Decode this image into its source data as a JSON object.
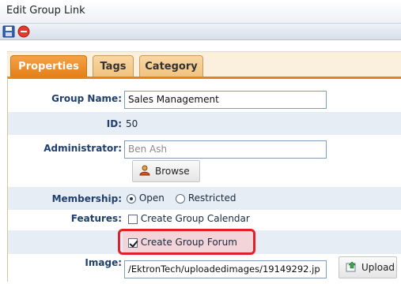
{
  "window": {
    "title": "Edit Group Link"
  },
  "toolbar": {
    "save_icon": "save-icon",
    "cancel_icon": "cancel-icon"
  },
  "tabs": [
    {
      "label": "Properties",
      "active": true
    },
    {
      "label": "Tags",
      "active": false
    },
    {
      "label": "Category",
      "active": false
    }
  ],
  "form": {
    "group_name": {
      "label": "Group Name:",
      "value": "Sales Management"
    },
    "id": {
      "label": "ID:",
      "value": "50"
    },
    "administrator": {
      "label": "Administrator:",
      "value": "Ben Ash",
      "browse_label": "Browse"
    },
    "membership": {
      "label": "Membership:",
      "options": [
        "Open",
        "Restricted"
      ],
      "selected": "Open"
    },
    "features": {
      "label": "Features:",
      "calendar": {
        "label": "Create Group Calendar",
        "checked": false
      },
      "forum": {
        "label": "Create Group Forum",
        "checked": true
      }
    },
    "image": {
      "label": "Image:",
      "value": "/EktronTech/uploadedimages/19149292.jp",
      "upload_label": "Upload"
    }
  },
  "colors": {
    "accent": "#e48519",
    "highlight": "#e0202a",
    "label": "#1f3f6e",
    "row_alt": "#e6edf4"
  }
}
